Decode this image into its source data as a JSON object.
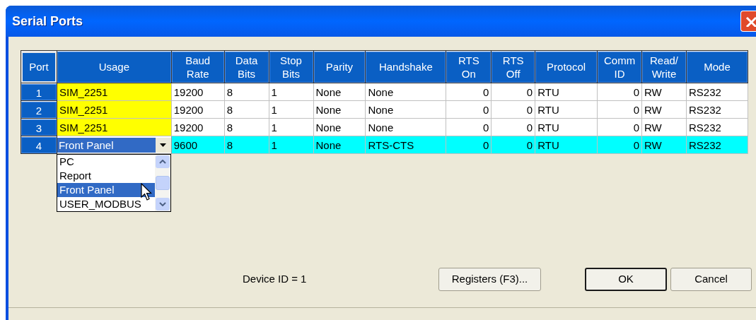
{
  "window": {
    "title": "Serial Ports"
  },
  "table": {
    "columns": [
      {
        "label": "Port",
        "kind": "port"
      },
      {
        "label": "Usage",
        "kind": "text"
      },
      {
        "label": "Baud\nRate",
        "kind": "text"
      },
      {
        "label": "Data\nBits",
        "kind": "text"
      },
      {
        "label": "Stop\nBits",
        "kind": "text"
      },
      {
        "label": "Parity",
        "kind": "text"
      },
      {
        "label": "Handshake",
        "kind": "text"
      },
      {
        "label": "RTS\nOn",
        "kind": "number"
      },
      {
        "label": "RTS\nOff",
        "kind": "number"
      },
      {
        "label": "Protocol",
        "kind": "text"
      },
      {
        "label": "Comm\nID",
        "kind": "number"
      },
      {
        "label": "Read/\nWrite",
        "kind": "text"
      },
      {
        "label": "Mode",
        "kind": "text"
      }
    ],
    "rows": [
      {
        "selected": false,
        "cells": [
          "1",
          "SIM_2251",
          "19200",
          "8",
          "1",
          "None",
          "None",
          "0",
          "0",
          "RTU",
          "0",
          "RW",
          "RS232"
        ]
      },
      {
        "selected": false,
        "cells": [
          "2",
          "SIM_2251",
          "19200",
          "8",
          "1",
          "None",
          "None",
          "0",
          "0",
          "RTU",
          "0",
          "RW",
          "RS232"
        ]
      },
      {
        "selected": false,
        "cells": [
          "3",
          "SIM_2251",
          "19200",
          "8",
          "1",
          "None",
          "None",
          "0",
          "0",
          "RTU",
          "0",
          "RW",
          "RS232"
        ]
      },
      {
        "selected": true,
        "cells": [
          "4",
          "Front Panel",
          "9600",
          "8",
          "1",
          "None",
          "RTS-CTS",
          "0",
          "0",
          "RTU",
          "0",
          "RW",
          "RS232"
        ]
      }
    ]
  },
  "dropdown": {
    "items": [
      {
        "label": "PC",
        "selected": false
      },
      {
        "label": "Report",
        "selected": false
      },
      {
        "label": "Front Panel",
        "selected": true
      },
      {
        "label": "USER_MODBUS",
        "selected": false
      }
    ]
  },
  "device_id": "Device ID = 1",
  "buttons": [
    {
      "label": "Registers (F3)...",
      "default": false
    },
    {
      "label": "OK",
      "default": true
    },
    {
      "label": "Cancel",
      "default": false
    }
  ]
}
